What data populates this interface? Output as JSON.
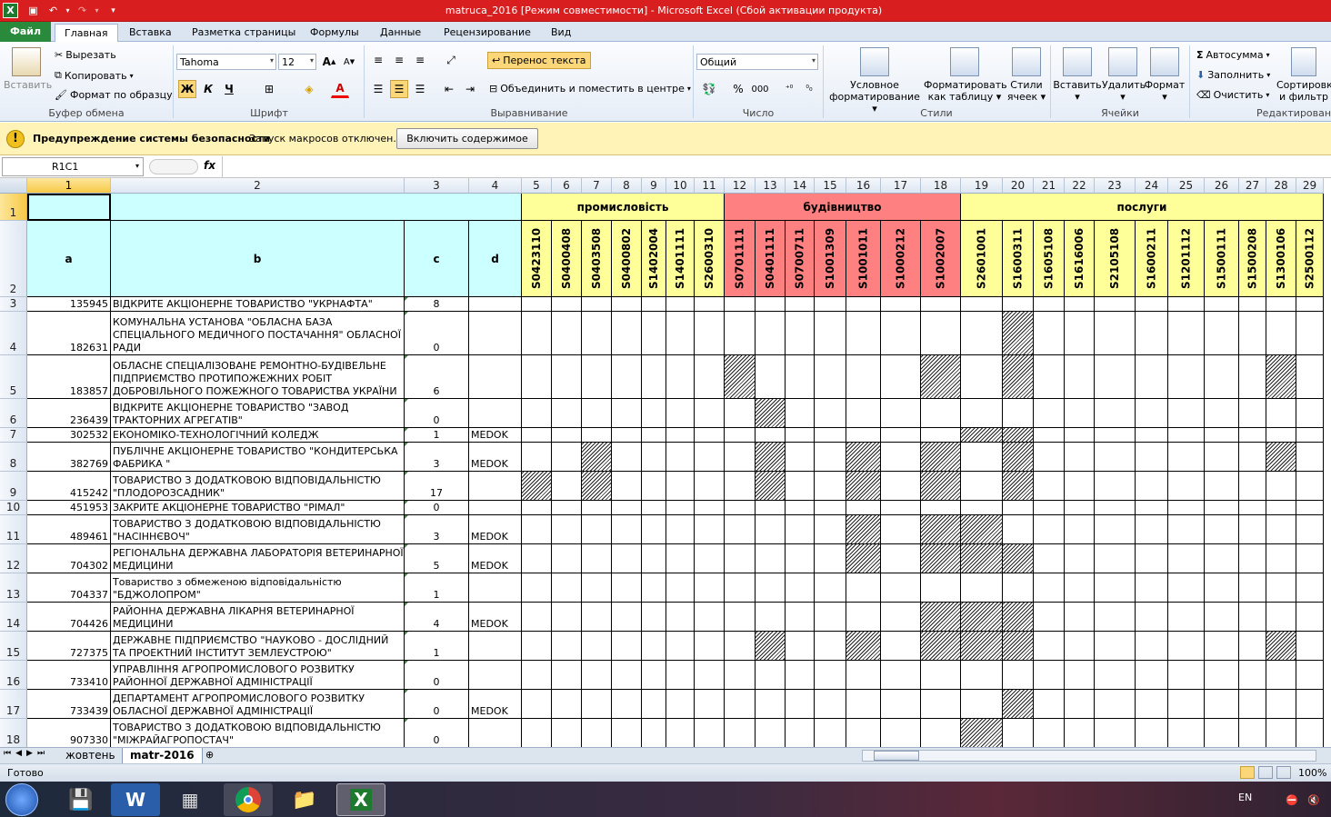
{
  "window": {
    "title": "matruca_2016  [Режим совместимости]  -  Microsoft Excel (Сбой активации продукта)"
  },
  "tabs": {
    "file": "Файл",
    "items": [
      "Главная",
      "Вставка",
      "Разметка страницы",
      "Формулы",
      "Данные",
      "Рецензирование",
      "Вид"
    ]
  },
  "ribbon": {
    "clipboard": {
      "paste": "Вставить",
      "cut": "Вырезать",
      "copy": "Копировать",
      "format_painter": "Формат по образцу",
      "label": "Буфер обмена"
    },
    "font": {
      "name": "Tahoma",
      "size": "12",
      "bold": "Ж",
      "italic": "К",
      "underline": "Ч",
      "label": "Шрифт"
    },
    "alignment": {
      "wrap": "Перенос текста",
      "merge": "Объединить и поместить в центре",
      "label": "Выравнивание"
    },
    "number": {
      "format": "Общий",
      "percent": "%",
      "thousands": "000",
      "label": "Число"
    },
    "styles": {
      "conditional": "Условное форматирование",
      "as_table": "Форматировать как таблицу",
      "cell_styles": "Стили ячеек",
      "label": "Стили"
    },
    "cells": {
      "insert": "Вставить",
      "delete": "Удалить",
      "format": "Формат",
      "label": "Ячейки"
    },
    "editing": {
      "autosum": "Автосумма",
      "fill": "Заполнить",
      "clear": "Очистить",
      "sort": "Сортировка и фильтр",
      "label": "Редактирование"
    }
  },
  "security": {
    "title": "Предупреждение системы безопасности",
    "message": "Запуск макросов отключен.",
    "button": "Включить содержимое"
  },
  "formula_bar": {
    "name_box": "R1C1",
    "fx": "fx",
    "value": ""
  },
  "sheet": {
    "columns": [
      "1",
      "2",
      "3",
      "4",
      "5",
      "6",
      "7",
      "8",
      "9",
      "10",
      "11",
      "12",
      "13",
      "14",
      "15",
      "16",
      "17",
      "18",
      "19",
      "20",
      "21",
      "22",
      "23",
      "24",
      "25",
      "26",
      "27",
      "28",
      "29"
    ],
    "row_numbers": [
      "1",
      "2",
      "3",
      "4",
      "5",
      "6",
      "7",
      "8",
      "9",
      "10",
      "11",
      "12",
      "13",
      "14",
      "15",
      "16",
      "17",
      "18"
    ],
    "sections": [
      {
        "label": "промисловість",
        "from": 5,
        "to": 11,
        "color": "#ffff99"
      },
      {
        "label": "будівництво",
        "from": 12,
        "to": 18,
        "color": "#ff8080"
      },
      {
        "label": "послуги",
        "from": 19,
        "to": 29,
        "color": "#ffff99"
      }
    ],
    "headers": {
      "a": "a",
      "b": "b",
      "c": "c",
      "d": "d"
    },
    "codes": [
      "S0423110",
      "S0400408",
      "S0403508",
      "S0400802",
      "S1402004",
      "S1401111",
      "S2600310",
      "S0701111",
      "S0401111",
      "S0700711",
      "S1001309",
      "S1001011",
      "S1000212",
      "S1002007",
      "S2601001",
      "S1600311",
      "S1605108",
      "S1616006",
      "S2105108",
      "S1600211",
      "S1201112",
      "S1500111",
      "S1500208",
      "S1300106",
      "S2500112"
    ],
    "rows": [
      {
        "a": "135945",
        "b": "ВІДКРИТЕ АКЦІОНЕРНЕ ТОВАРИСТВО \"УКРНАФТА\"",
        "c": "8",
        "d": "",
        "hatch": []
      },
      {
        "a": "182631",
        "b": "КОМУНАЛЬНА УСТАНОВА \"ОБЛАСНА БАЗА СПЕЦІАЛЬНОГО МЕДИЧНОГО ПОСТАЧАННЯ\" ОБЛАСНОЇ РАДИ",
        "c": "0",
        "d": "",
        "hatch": [
          20
        ]
      },
      {
        "a": "183857",
        "b": "ОБЛАСНЕ СПЕЦІАЛІЗОВАНЕ РЕМОНТНО-БУДІВЕЛЬНЕ ПІДПРИЄМСТВО ПРОТИПОЖЕЖНИХ РОБІТ ДОБРОВІЛЬНОГО ПОЖЕЖНОГО ТОВАРИСТВА УКРАЇНИ",
        "c": "6",
        "d": "",
        "hatch": [
          12,
          18,
          20,
          28
        ]
      },
      {
        "a": "236439",
        "b": "ВІДКРИТЕ АКЦІОНЕРНЕ ТОВАРИСТВО \"ЗАВОД ТРАКТОРНИХ АГРЕГАТІВ\"",
        "c": "0",
        "d": "",
        "hatch": [
          13
        ]
      },
      {
        "a": "302532",
        "b": "ЕКОНОМІКО-ТЕХНОЛОГІЧНИЙ КОЛЕДЖ",
        "c": "1",
        "d": "MEDOK",
        "hatch": [
          19,
          20
        ]
      },
      {
        "a": "382769",
        "b": "ПУБЛІЧНЕ АКЦІОНЕРНЕ ТОВАРИСТВО \"КОНДИТЕРСЬКА ФАБРИКА \"",
        "c": "3",
        "d": "MEDOK",
        "hatch": [
          7,
          13,
          16,
          18,
          20,
          28
        ]
      },
      {
        "a": "415242",
        "b": "ТОВАРИСТВО З ДОДАТКОВОЮ ВІДПОВІДАЛЬНІСТЮ \"ПЛОДОРОЗСАДНИК\"",
        "c": "17",
        "d": "",
        "hatch": [
          5,
          7,
          13,
          16,
          18,
          20
        ]
      },
      {
        "a": "451953",
        "b": "ЗАКРИТЕ АКЦІОНЕРНЕ ТОВАРИСТВО \"РІМАЛ\"",
        "c": "0",
        "d": "",
        "hatch": []
      },
      {
        "a": "489461",
        "b": "ТОВАРИСТВО З ДОДАТКОВОЮ ВІДПОВІДАЛЬНІСТЮ \"НАСІННЄВОЧ\"",
        "c": "3",
        "d": "MEDOK",
        "hatch": [
          16,
          18,
          19
        ]
      },
      {
        "a": "704302",
        "b": "РЕГІОНАЛЬНА ДЕРЖАВНА ЛАБОРАТОРІЯ ВЕТЕРИНАРНОЇ МЕДИЦИНИ",
        "c": "5",
        "d": "MEDOK",
        "hatch": [
          16,
          18,
          19,
          20
        ]
      },
      {
        "a": "704337",
        "b": "Товариство з обмеженою відповідальністю \"БДЖОЛОПРОМ\"",
        "c": "1",
        "d": "",
        "hatch": []
      },
      {
        "a": "704426",
        "b": "РАЙОННА ДЕРЖАВНА ЛІКАРНЯ ВЕТЕРИНАРНОЇ МЕДИЦИНИ",
        "c": "4",
        "d": "MEDOK",
        "hatch": [
          18,
          19,
          20
        ]
      },
      {
        "a": "727375",
        "b": "ДЕРЖАВНЕ ПІДПРИЄМСТВО \"НАУКОВО - ДОСЛІДНИЙ ТА ПРОЕКТНИЙ ІНСТИТУТ ЗЕМЛЕУСТРОЮ\"",
        "c": "1",
        "d": "",
        "hatch": [
          13,
          16,
          18,
          19,
          20,
          28
        ]
      },
      {
        "a": "733410",
        "b": "УПРАВЛІННЯ АГРОПРОМИСЛОВОГО РОЗВИТКУ РАЙОННОЇ ДЕРЖАВНОЇ АДМІНІСТРАЦІЇ",
        "c": "0",
        "d": "",
        "hatch": []
      },
      {
        "a": "733439",
        "b": "ДЕПАРТАМЕНТ АГРОПРОМИСЛОВОГО РОЗВИТКУ ОБЛАСНОЇ ДЕРЖАВНОЇ АДМІНІСТРАЦІЇ",
        "c": "0",
        "d": "MEDOK",
        "hatch": [
          20
        ]
      },
      {
        "a": "907330",
        "b": "ТОВАРИСТВО З ДОДАТКОВОЮ ВІДПОВІДАЛЬНІСТЮ \"МІЖРАЙАГРОПОСТАЧ\"",
        "c": "0",
        "d": "",
        "hatch": [
          19
        ]
      }
    ]
  },
  "sheet_tabs": [
    "жовтень",
    "matr-2016"
  ],
  "status": {
    "ready": "Готово",
    "zoom": "100%"
  },
  "taskbar": {
    "lang": "EN"
  }
}
